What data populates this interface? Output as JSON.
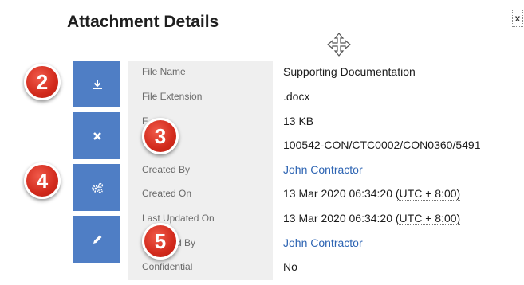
{
  "panel": {
    "title": "Attachment Details",
    "close_label": "x"
  },
  "actions": [
    {
      "name": "download-button",
      "icon": "download-icon"
    },
    {
      "name": "delete-button",
      "icon": "close-icon"
    },
    {
      "name": "settings-button",
      "icon": "gears-icon"
    },
    {
      "name": "edit-button",
      "icon": "pencil-icon"
    }
  ],
  "details": [
    {
      "label": "File Name",
      "value": "Supporting Documentation"
    },
    {
      "label": "File Extension",
      "value": ".docx"
    },
    {
      "label": "F",
      "value": "13 KB"
    },
    {
      "label": "",
      "value": "100542-CON/CTC0002/CON0360/5491"
    },
    {
      "label": "Created By",
      "value": "John Contractor"
    },
    {
      "label": "Created On",
      "value": "13 Mar 2020 06:34:20",
      "tz": "(UTC + 8:00)"
    },
    {
      "label": "Last Updated On",
      "value": "13 Mar 2020 06:34:20",
      "tz": "(UTC + 8:00)"
    },
    {
      "label": "ted By",
      "value": "John Contractor"
    },
    {
      "label": "Confidential",
      "value": "No"
    }
  ],
  "badges": [
    "2",
    "3",
    "4",
    "5"
  ],
  "colors": {
    "button_blue": "#4f7ec5",
    "link_blue": "#2d64b3",
    "badge_red": "#d22a1c",
    "label_panel": "#efefef"
  }
}
